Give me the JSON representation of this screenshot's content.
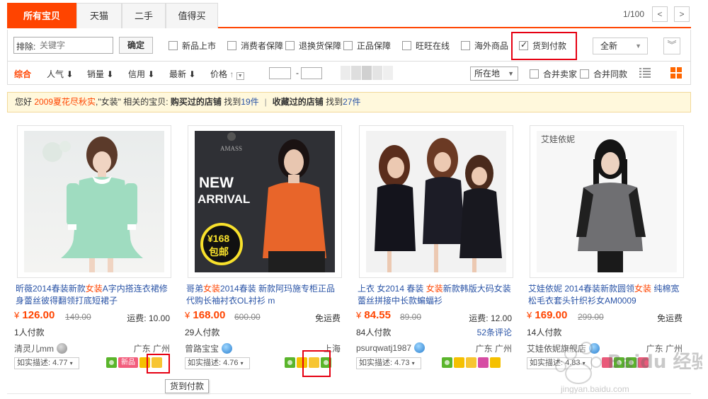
{
  "tabs": [
    {
      "label": "所有宝贝",
      "active": true
    },
    {
      "label": "天猫",
      "active": false
    },
    {
      "label": "二手",
      "active": false
    },
    {
      "label": "值得买",
      "active": false
    }
  ],
  "pager": {
    "text": "1/100",
    "prev": "<",
    "next": ">"
  },
  "filter": {
    "exclude_label": "排除:",
    "exclude_placeholder": "关键字",
    "confirm": "确定",
    "options": [
      {
        "label": "新品上市",
        "checked": false
      },
      {
        "label": "消费者保障",
        "checked": false
      },
      {
        "label": "退换货保障",
        "checked": false
      },
      {
        "label": "正品保障",
        "checked": false
      },
      {
        "label": "旺旺在线",
        "checked": false
      },
      {
        "label": "海外商品",
        "checked": false
      },
      {
        "label": "货到付款",
        "checked": true
      }
    ],
    "condition_select": "全新",
    "expand": "︾"
  },
  "sort": {
    "items": [
      "综合",
      "人气",
      "销量",
      "信用",
      "最新",
      "价格"
    ],
    "active": "综合",
    "price_dash": "-",
    "location": "所在地",
    "merge_seller": "合并卖家",
    "merge_same": "合并同款"
  },
  "notice": {
    "p1": "您好 ",
    "keyword": "2009夏花尽秋实",
    "p2": ",\"女装\" 相关的宝贝: ",
    "bought": "购买过的店铺",
    "found1": " 找到",
    "count1": "19件",
    "sep": "|",
    "fav": "收藏过的店铺",
    "found2": " 找到",
    "count2": "27件"
  },
  "products": [
    {
      "title_a": "昕薇2014春装新款",
      "title_kw": "女装",
      "title_b": "A字内搭连衣裙修身蕾丝彼得翻领打底短裙子",
      "price": "126.00",
      "orig": "149.00",
      "shipping": "运费: 10.00",
      "paid": "1人付款",
      "reviews": "",
      "seller": "清灵儿mm",
      "location": "广东 广州",
      "desc": "如实描述: 4.77",
      "new_badge": "新品"
    },
    {
      "title_a": "哥弟",
      "title_kw": "女装",
      "title_b": "2014春装 新款阿玛施专柜正品代购长袖衬衣OL衬衫 m",
      "price": "168.00",
      "orig": "600.00",
      "shipping": "免运费",
      "paid": "29人付款",
      "reviews": "",
      "seller": "曾路宝宝",
      "location": "上海",
      "desc": "如实描述: 4.76",
      "image_text_1": "AMASS",
      "image_text_2": "NEW",
      "image_text_3": "ARRIVAL",
      "image_text_4": "¥168",
      "image_text_5": "包邮"
    },
    {
      "title_a": "上衣 女2014 春装 ",
      "title_kw": "女装",
      "title_b": "新款韩版大码女装蕾丝拼接中长款蝙蝠衫",
      "price": "84.55",
      "orig": "89.00",
      "shipping": "运费: 12.00",
      "paid": "84人付款",
      "reviews": "52条评论",
      "seller": "psurqwatj1987",
      "location": "广东 广州",
      "desc": "如实描述: 4.73"
    },
    {
      "title_a": "艾娃依妮 2014春装新款圆领",
      "title_kw": "女装",
      "title_b": " 纯棉宽松毛衣套头针织衫女AM0009",
      "price": "169.00",
      "orig": "299.00",
      "shipping": "免运费",
      "paid": "14人付款",
      "reviews": "",
      "seller": "艾娃依妮旗舰店",
      "location": "广东 广州",
      "desc": "如实描述: 4.83",
      "image_text_1": "艾娃依妮"
    }
  ],
  "currency": "¥",
  "tooltip": "货到付款",
  "watermark": {
    "text1": "Baidu 经验",
    "text2": "jingyan.baidu.com"
  },
  "colors": {
    "accent": "#ff4400",
    "link": "#2953a6",
    "highlight": "#e60012",
    "notice_bg": "#fff8dc"
  }
}
